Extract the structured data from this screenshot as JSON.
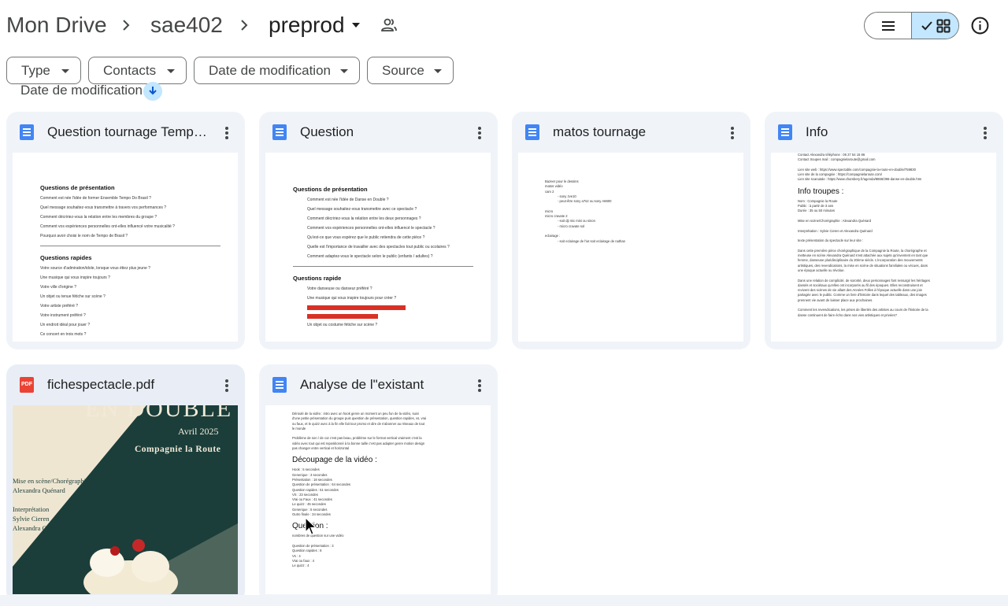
{
  "breadcrumb": {
    "root": "Mon Drive",
    "parent": "sae402",
    "current": "preprod"
  },
  "filters": {
    "type": "Type",
    "contacts": "Contacts",
    "modified": "Date de modification",
    "source": "Source"
  },
  "sort": {
    "label": "Date de modification"
  },
  "files": [
    {
      "name": "Question tournage Tempo…",
      "kind": "document",
      "preview": {
        "h1": "Questions de présentation",
        "lines1": [
          "Comment est née l'idée de former Ensemble Tempo Do Brasil ?",
          "Quel message souhaitez-vous transmettre à travers vos performances ?",
          "Comment décririez-vous la relation entre les membres du groupe ?",
          "Comment vos expériences personnelles ont-elles influencé votre musicalité ?",
          "Pourquoi avoir choisi le nom de Tempo de Brasil ?"
        ],
        "h2": "Questions rapides",
        "lines2": [
          "Votre source d'admiration/idole, lorsque vous étiez plus jeune ?",
          "Une musique qui vous inspire toujours ?",
          "Votre ville d'origine ?",
          "Un objet ou tenue fétiche sur scène ?",
          "Votre artiste préféré ?",
          "Votre instrument préféré ?",
          "Un endroit idéal pour jouer ?",
          "Ce concert en trois mots ?"
        ]
      }
    },
    {
      "name": "Question",
      "kind": "document",
      "preview": {
        "h1": "Questions de présentation",
        "lines1": [
          "Comment est née l'idée de Danse en Double ?",
          "Quel message souhaitez-vous transmettre avec ce spectacle ?",
          "Comment décririez-vous la relation entre les deux personnages ?",
          "Comment vos expériences personnelles ont-elles influencé le spectacle ?",
          "Qu'est-ce que vous espérez que le public retiendra de cette pièce ?",
          "Quelle est l'importance de travailler avec des spectacles tout public ou scolaires ?",
          "Comment adaptez-vous le spectacle selon le public (enfants / adultes) ?"
        ],
        "h2": "Questions rapide",
        "lines2": [
          "Votre danseuse ou danseur préféré ?",
          "Une musique qui vous inspire toujours pour créer ?",
          "Un objet ou costume fétiche sur scène ?"
        ]
      }
    },
    {
      "name": "matos tournage",
      "kind": "document",
      "preview": {
        "lines": [
          "Bazeer pour le dessins",
          "",
          "matos vidéo",
          "cam 2",
          "- sony zve10",
          "- peut-être sony a7s2 ou sony A6600",
          "",
          "micro",
          "micro cravate 2",
          "- soit dji mic mini ou sinon",
          "- micro cravate sol",
          "",
          "eclairage :",
          "- soit eclairage de l'iut soit eclairage de nathan"
        ]
      }
    },
    {
      "name": "Info",
      "kind": "document",
      "preview": {
        "top": [
          "Contact Alexandra téléphone : 06 27 54 15 86",
          "Contact troupes mail : compagnielaroute@gmail.com",
          "",
          "Lien site web : https://www.spectable.com/compagnie-la-route-en-double/759830",
          "Lien site de la compagnie : https://compagnielaroute.com/",
          "Lien site scanutale : https://www.chambery.fr/agenda/8866/396-danse-en-double.htm"
        ],
        "heading": "Info troupes :",
        "body": [
          "Nom : Compagnie la Route",
          "Public : à partir de 3 ans",
          "Durée : 35 ou 50 minutes",
          "",
          "Mise en scène/Chorégraphie : Alexandra Quénard",
          "",
          "Interprétation : Sylvie Cieren et Alexandra Quénard",
          "",
          "texte présentation du spectacle sur leur site :",
          "",
          "Dans cette première pièce chorégraphique de la Compagnie la Route, la chorégraphe et",
          "metteuse en scène Alexandra Quénard s'est attachée aux sujets qu'inventent en tant que",
          "femme, danseuse pluridisciplinaire du 20ème siècle. L'incorporation des mouvements",
          "artistiques, des revendications, la mise en scène de situations familiales ou vécues, dans",
          "une époque actuelle ou révolue.",
          "",
          "Dans une relation de complicité, de sororité, deux personnages font ressurgir les héritages",
          "dansés et sociétaux qu'elles ont incorporés au fil des époques. Elles reconstruisent et",
          "revivent des scènes de vie allant des Années Folles à l'époque actuelle dans une joie",
          "partagée avec le public. Comme un livre d'histoire dans lequel des tableaux, des images",
          "prennent vie avant de laisser place aux prochaines.",
          "",
          "Comment les revendications, les prises de libertés des artistes au cours de l'histoire de la",
          "danse continuent de faire écho dans nos vies artistiques et privées?"
        ]
      }
    },
    {
      "name": "fichespectacle.pdf",
      "kind": "pdf",
      "icon_label": "PDF",
      "preview": {
        "title": "EN DOUBLE",
        "date": "Avril 2025",
        "company": "Compagnie la Route",
        "credits": [
          "Mise en scène/Chorégraphie",
          "Alexandra Quénard",
          "",
          "Interprétation",
          "Sylvie Cieren",
          "Alexandra Quénard"
        ]
      }
    },
    {
      "name": "Analyse de l\"existant",
      "kind": "document",
      "preview": {
        "intro": [
          "Déroulé de la vidéo : intro avec un hook genre un moment un peu fun de la vidéo, suivi",
          "d'une petite présentation du groupe puis question de présentation, question rapides, vs, vrai",
          "ou faux, et le quizz avec à la fin elle fait tour promo et dire de s'abonner au réseaux de tout",
          "le monde",
          "",
          "Problème de son / de cut c'est pas beau, problème sur le format vertical vraiment c'est la",
          "vidéo avec tout qui est repositionné à la bonne taille c'est pas adapter genre motion design",
          "pas changer entre vertical et horizontal"
        ],
        "heading1": "Découpage de la vidéo :",
        "timings": [
          "Hook : 5 secondes",
          "Generique : 3 secondes",
          "Présentation : 18 secondes",
          "Question de présentation : 64 secondes",
          "Question rapides : 51 secondes",
          "VS : 23 secondes",
          "Vrai ou Faux : 41 secondes",
          "Le quizz : 45 secondes",
          "Generique : 5 secondes",
          "Outro finale : 34 secondes"
        ],
        "heading2": "Question :",
        "qintro": "nombres de question sur une vidéo",
        "counts": [
          "Question de présentation : 3",
          "Question rapides : 8",
          "Vs : 4",
          "Vrai ou faux : 4",
          "Le quizz : 4"
        ]
      }
    }
  ]
}
